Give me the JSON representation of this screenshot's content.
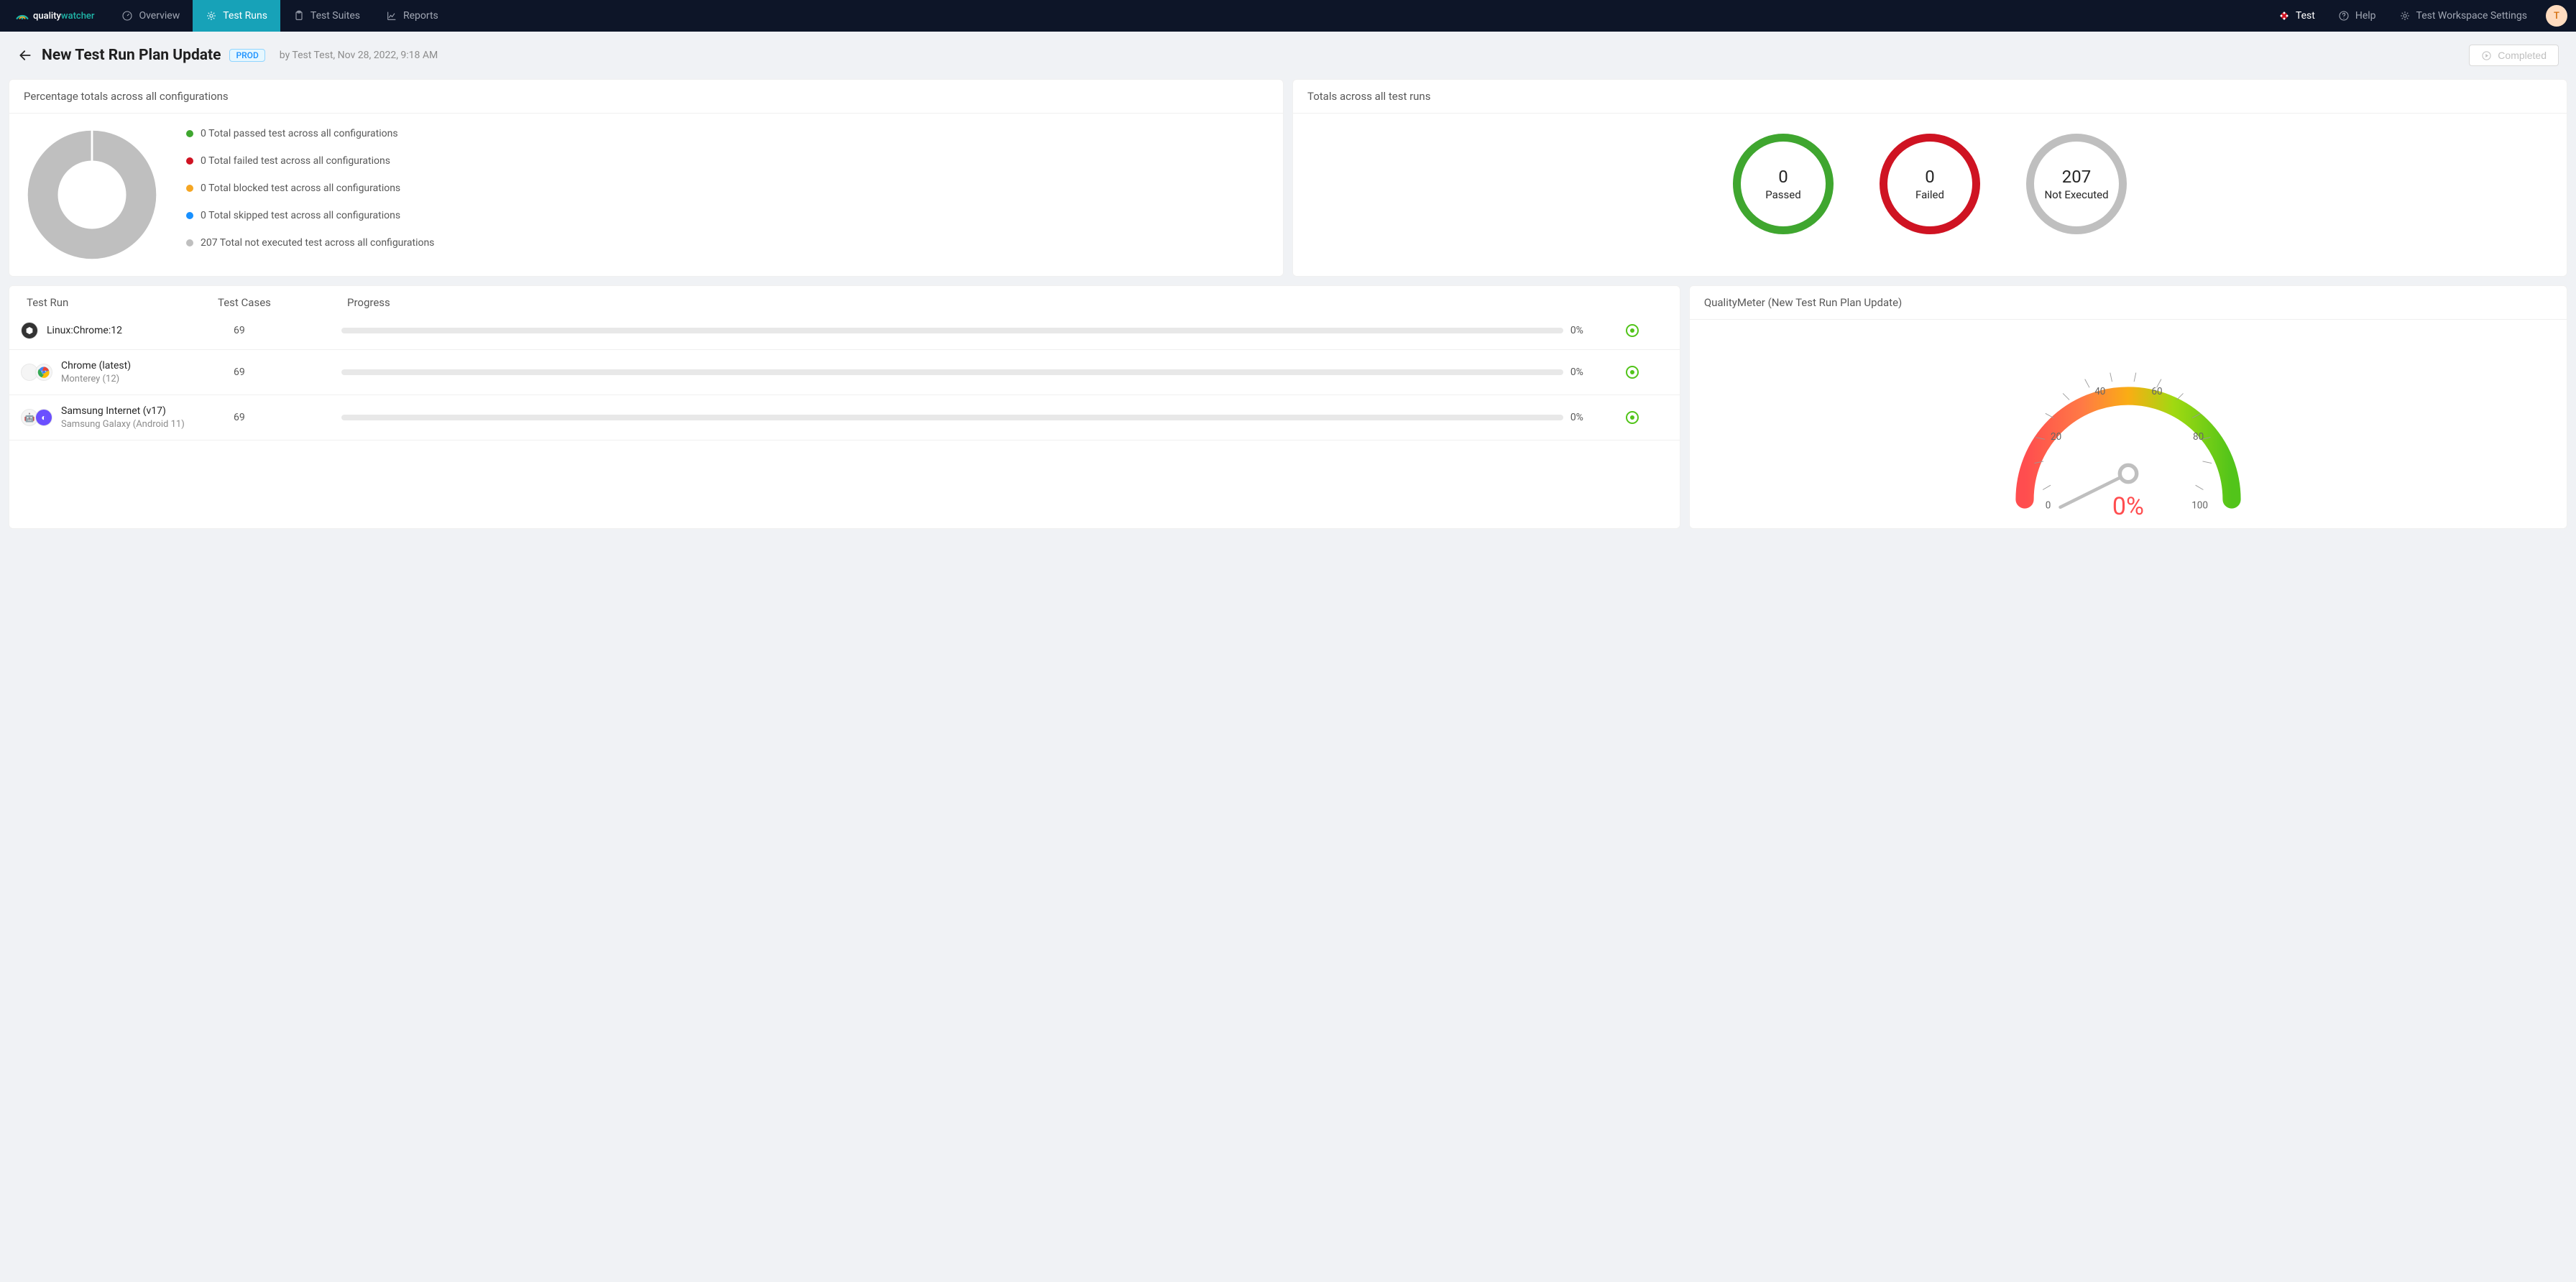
{
  "brand": {
    "name1": "quality",
    "name2": "watcher"
  },
  "nav": {
    "overview": "Overview",
    "testruns": "Test Runs",
    "testsuites": "Test Suites",
    "reports": "Reports",
    "test": "Test",
    "help": "Help",
    "workspace": "Test Workspace Settings",
    "avatar_initial": "T"
  },
  "header": {
    "title": "New Test Run Plan Update",
    "env": "PROD",
    "byline": "by Test Test, Nov 28, 2022, 9:18 AM",
    "completed_label": "Completed"
  },
  "percent_card": {
    "title": "Percentage totals across all configurations",
    "legend": {
      "passed": "0 Total passed test across all configurations",
      "failed": "0 Total failed test across all configurations",
      "blocked": "0 Total blocked test across all configurations",
      "skipped": "0 Total skipped test across all configurations",
      "notexec": "207 Total not executed test across all configurations"
    }
  },
  "totals_card": {
    "title": "Totals across all test runs",
    "passed_n": "0",
    "passed_l": "Passed",
    "failed_n": "0",
    "failed_l": "Failed",
    "notexec_n": "207",
    "notexec_l": "Not Executed"
  },
  "runs_card": {
    "h_name": "Test Run",
    "h_cases": "Test Cases",
    "h_progress": "Progress",
    "rows": [
      {
        "name": "Linux:Chrome:12",
        "sub": "",
        "cases": "69",
        "pct": "0%"
      },
      {
        "name": "Chrome (latest)",
        "sub": "Monterey (12)",
        "cases": "69",
        "pct": "0%"
      },
      {
        "name": "Samsung Internet (v17)",
        "sub": "Samsung Galaxy (Android 11)",
        "cases": "69",
        "pct": "0%"
      }
    ]
  },
  "meter_card": {
    "title": "QualityMeter (New Test Run Plan Update)",
    "pct": "0%",
    "tick0": "0",
    "tick20": "20",
    "tick40": "40",
    "tick60": "60",
    "tick80": "80",
    "tick100": "100"
  },
  "colors": {
    "passed": "#3fa62f",
    "failed": "#cf1322",
    "blocked": "#f5a623",
    "skipped": "#1890ff",
    "notexec": "#bfbfbf"
  },
  "chart_data": [
    {
      "type": "pie",
      "title": "Percentage totals across all configurations",
      "categories": [
        "Passed",
        "Failed",
        "Blocked",
        "Skipped",
        "Not Executed"
      ],
      "values": [
        0,
        0,
        0,
        0,
        207
      ],
      "colors": [
        "#3fa62f",
        "#cf1322",
        "#f5a623",
        "#1890ff",
        "#bfbfbf"
      ]
    },
    {
      "type": "bar",
      "title": "Totals across all test runs",
      "categories": [
        "Passed",
        "Failed",
        "Not Executed"
      ],
      "values": [
        0,
        0,
        207
      ]
    },
    {
      "type": "table",
      "title": "Test Run progress",
      "columns": [
        "Test Run",
        "Test Cases",
        "Progress %"
      ],
      "rows": [
        [
          "Linux:Chrome:12",
          69,
          0
        ],
        [
          "Chrome (latest) / Monterey (12)",
          69,
          0
        ],
        [
          "Samsung Internet (v17) / Samsung Galaxy (Android 11)",
          69,
          0
        ]
      ]
    },
    {
      "type": "gauge",
      "title": "QualityMeter (New Test Run Plan Update)",
      "value": 0,
      "min": 0,
      "max": 100,
      "ticks": [
        0,
        20,
        40,
        60,
        80,
        100
      ]
    }
  ]
}
